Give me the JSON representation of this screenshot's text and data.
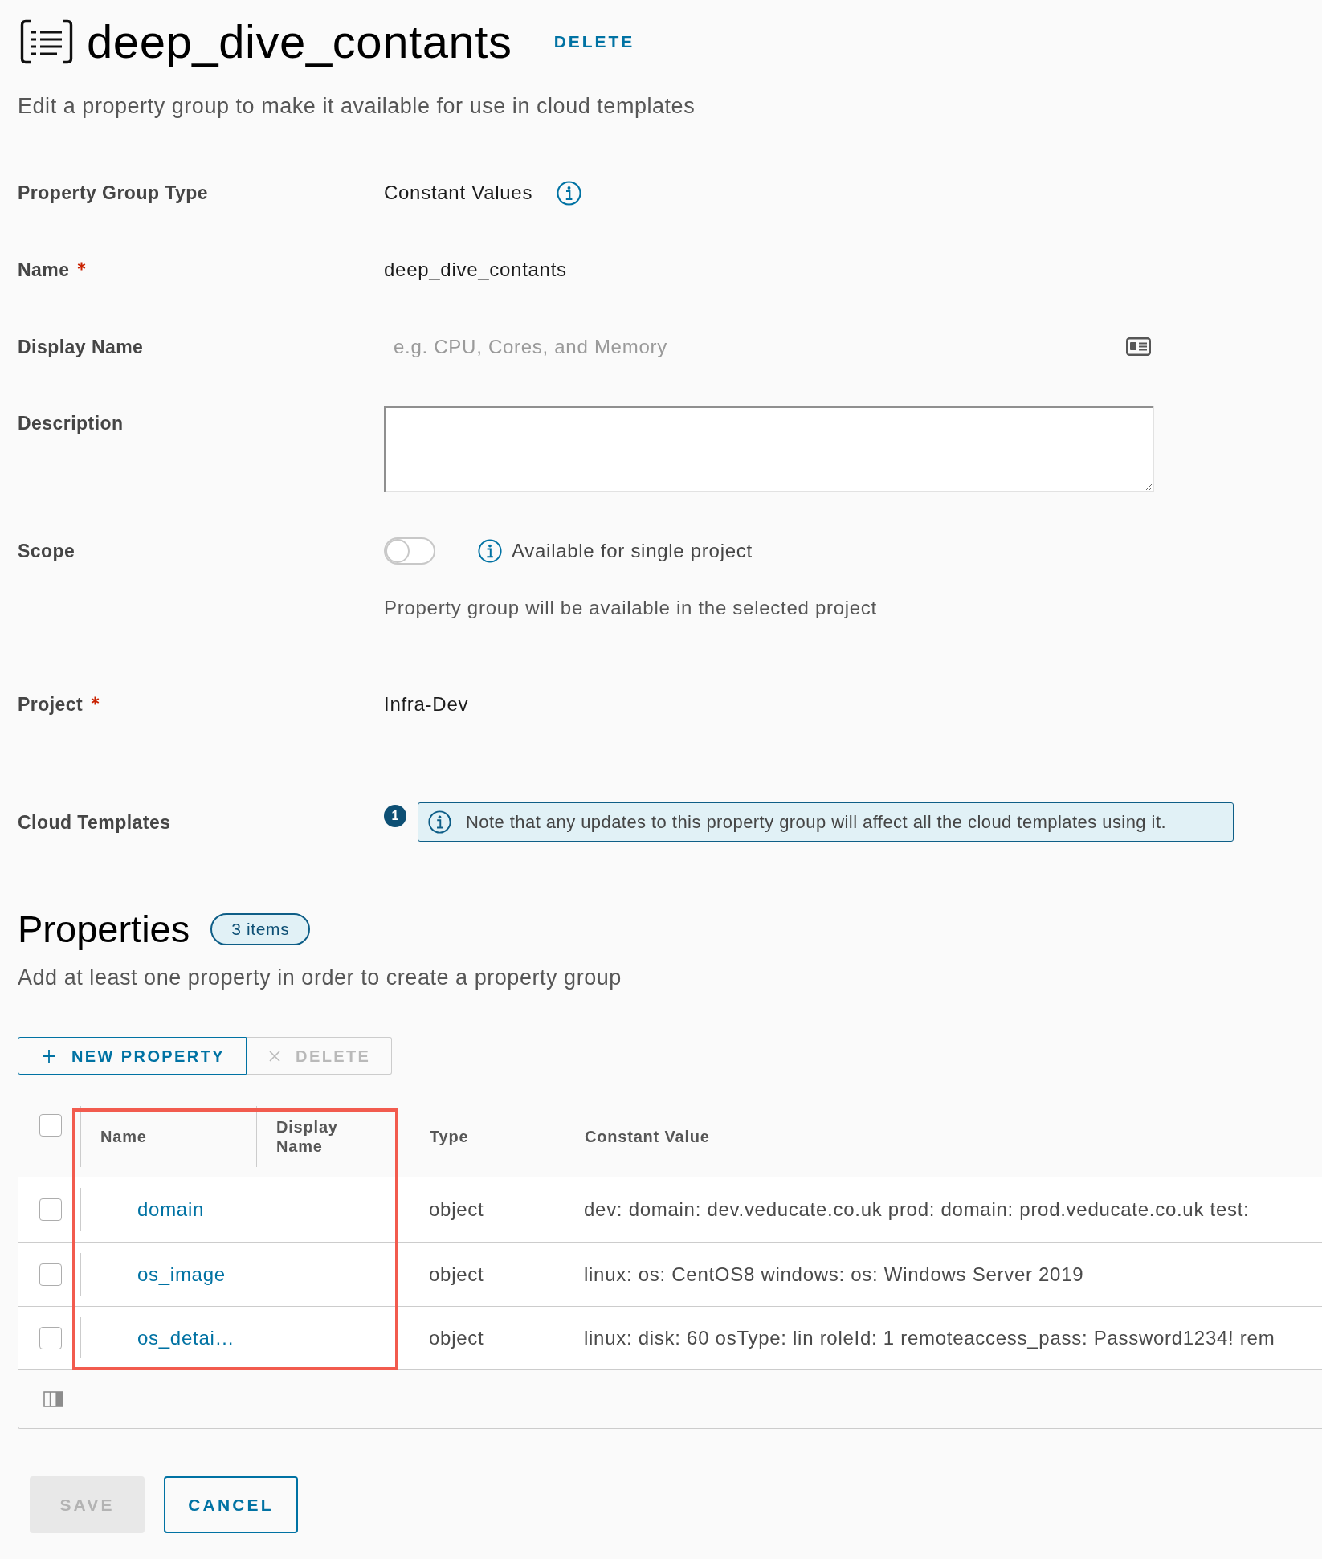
{
  "header": {
    "title": "deep_dive_contants",
    "action": "DELETE"
  },
  "subtitle": "Edit a property group to make it available for use in cloud templates",
  "form": [
    {
      "kind": "text",
      "label": "Property Group Type",
      "required": false,
      "value": "Constant Values",
      "info": true
    },
    {
      "kind": "text",
      "label": "Name",
      "required": true,
      "value": "deep_dive_contants",
      "info": false
    },
    {
      "kind": "input",
      "label": "Display Name",
      "required": false,
      "placeholder": "e.g. CPU, Cores, and Memory"
    },
    {
      "kind": "textarea",
      "label": "Description",
      "required": false
    },
    {
      "kind": "toggle",
      "label": "Scope",
      "required": false,
      "on": false,
      "toggle_label": "Available for single project",
      "helper": "Property group will be available in the selected project"
    },
    {
      "kind": "text",
      "label": "Project",
      "required": true,
      "value": "Infra-Dev",
      "info": false
    },
    {
      "kind": "alert",
      "label": "Cloud Templates",
      "required": false,
      "count": "1",
      "message": "Note that any updates to this property group will affect all the cloud templates using it."
    }
  ],
  "properties": {
    "title": "Properties",
    "count": "3 items",
    "description": "Add at least one property in order to create a property group",
    "toolbar": [
      {
        "kind": "add",
        "label": "NEW PROPERTY",
        "disabled": false
      },
      {
        "kind": "delete",
        "label": "DELETE",
        "disabled": true
      }
    ],
    "table": {
      "select_all_checked": false,
      "columns": [
        "Name",
        "Display Name",
        "Type",
        "Constant Value"
      ],
      "rows": [
        {
          "checked": false,
          "name": "domain",
          "type": "object",
          "constant_value": "dev: domain: dev.veducate.co.uk prod: domain: prod.veducate.co.uk test:"
        },
        {
          "checked": false,
          "name": "os_image",
          "type": "object",
          "constant_value": "linux: os: CentOS8 windows: os: Windows Server 2019"
        },
        {
          "checked": false,
          "name": "os_detai…",
          "type": "object",
          "constant_value": "linux: disk: 60 osType: lin roleId: 1 remoteaccess_pass: Password1234! rem"
        }
      ]
    }
  },
  "buttons": [
    {
      "kind": "primary",
      "label": "SAVE",
      "disabled": true
    },
    {
      "kind": "outline",
      "label": "CANCEL",
      "disabled": false
    }
  ],
  "annotation": {
    "kind": "highlight"
  }
}
